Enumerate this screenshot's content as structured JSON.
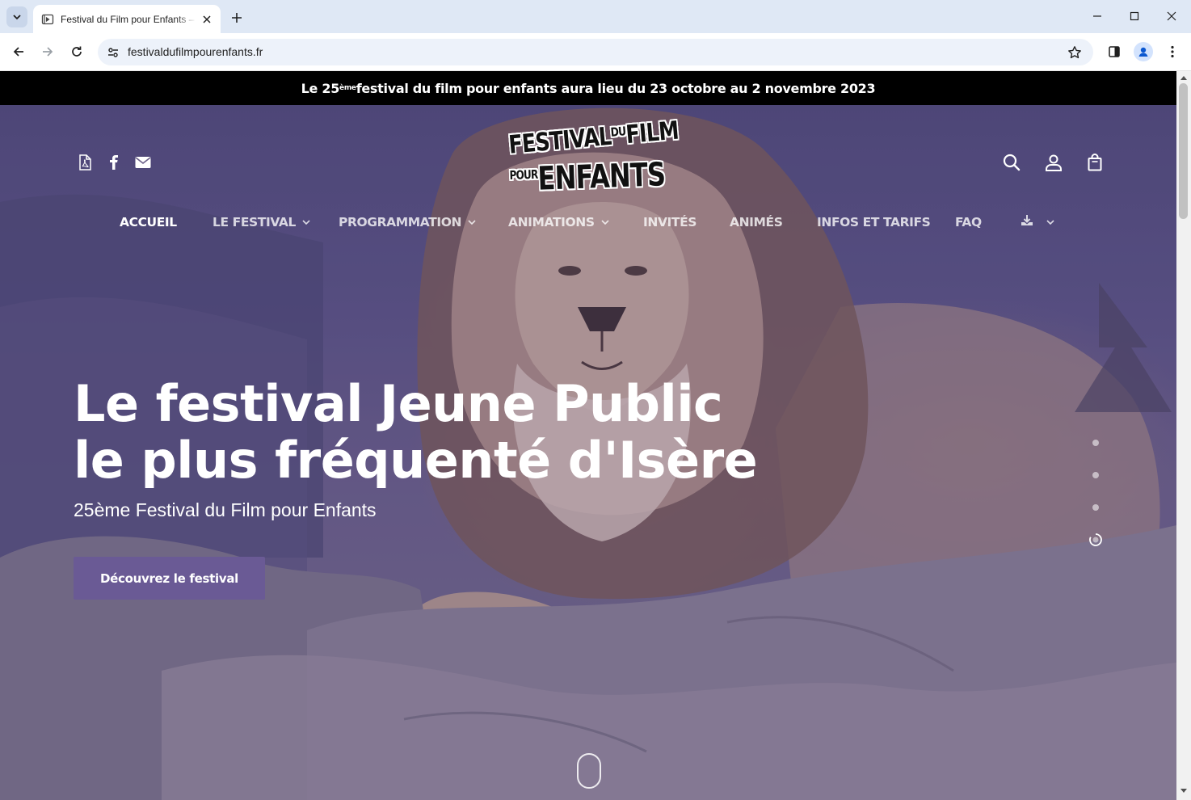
{
  "browser": {
    "tab_title": "Festival du Film pour Enfants – Le festival Jeune Public",
    "url": "festivaldufilmpourenfants.fr",
    "icons": [
      "tab-search-icon",
      "favicon-icon",
      "close-icon",
      "plus-icon",
      "minimize-icon",
      "maximize-icon",
      "close-window-icon",
      "back-icon",
      "forward-icon",
      "reload-icon",
      "site-info-icon",
      "star-icon",
      "side-panel-icon",
      "profile-icon",
      "kebab-menu-icon"
    ]
  },
  "announcement": {
    "prefix": "Le 25",
    "sup": "ème",
    "suffix": " festival du film pour enfants aura lieu du 23 octobre au 2 novembre 2023"
  },
  "logo": {
    "line1_a": "FESTIVAL",
    "line1_b": "DU",
    "line1_c": "FILM",
    "line2_a": "POUR",
    "line2_b": "ENFANTS"
  },
  "header_icons": {
    "left": [
      "pdf-icon",
      "facebook-icon",
      "mail-icon"
    ],
    "right": [
      "search-icon",
      "account-icon",
      "cart-icon"
    ]
  },
  "nav": {
    "items": [
      {
        "label": "ACCUEIL",
        "active": true,
        "dropdown": false
      },
      {
        "label": "LE FESTIVAL",
        "active": false,
        "dropdown": true
      },
      {
        "label": "PROGRAMMATION",
        "active": false,
        "dropdown": true
      },
      {
        "label": "ANIMATIONS",
        "active": false,
        "dropdown": true
      },
      {
        "label": "INVITÉS",
        "active": false,
        "dropdown": false
      },
      {
        "label": "ANIMÉS",
        "active": false,
        "dropdown": false
      },
      {
        "label": "INFOS ET TARIFS",
        "active": false,
        "dropdown": false
      },
      {
        "label": "FAQ",
        "active": false,
        "dropdown": false
      }
    ],
    "download_icon": "download-icon"
  },
  "hero": {
    "title_line1": "Le festival Jeune Public",
    "title_line2": "le plus fréquenté d'Isère",
    "subtitle": "25ème Festival du Film pour Enfants",
    "cta_label": "Découvrez le festival",
    "slides_total": 4,
    "slide_active": 4
  },
  "colors": {
    "announcement_bg": "#000000",
    "cta_bg": "#6a5a95",
    "hero_tint": "#5a5383"
  }
}
